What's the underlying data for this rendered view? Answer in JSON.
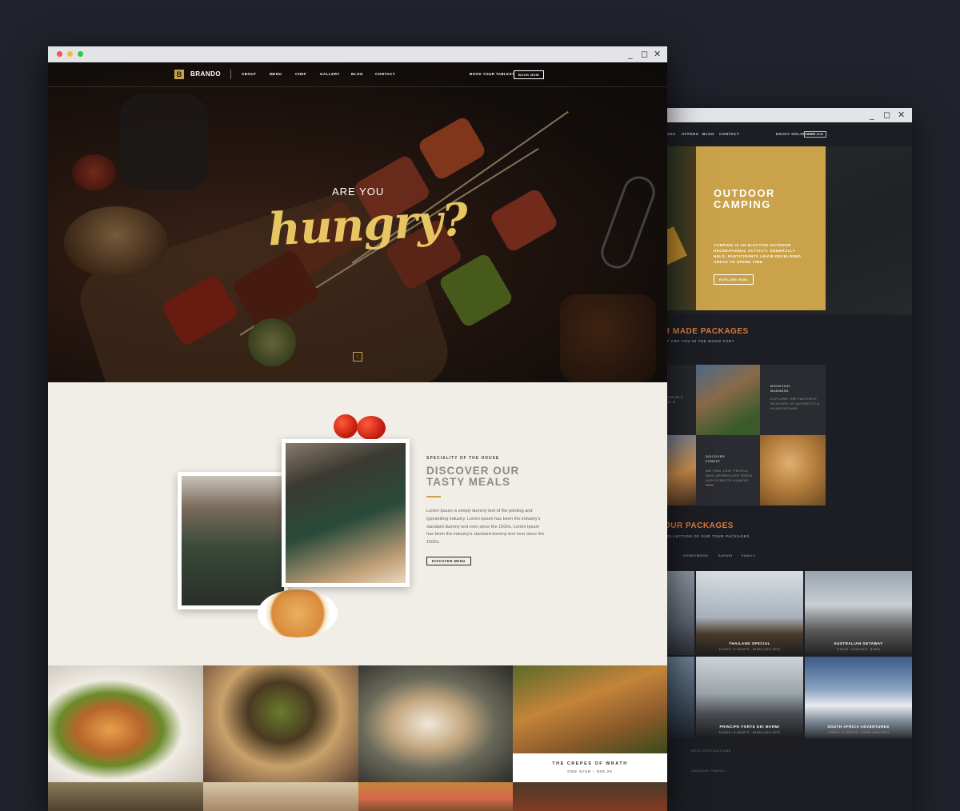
{
  "back_window": {
    "nav": [
      "ICES",
      "OFFERS",
      "BLOG",
      "CONTACT"
    ],
    "nav_cta_text": "ENJOY HOLIDAYS?",
    "nav_cta_button": "BOOK NOW",
    "hero": {
      "title_line1": "OUTDOOR",
      "title_line2": "CAMPING",
      "text": "CAMPING IS AN ELECTIVE OUTDOOR RECREATIONAL ACTIVITY. GENERALLY HELD, PARTICIPANTS LEAVE DEVELOPED AREAS TO SPEND TIME.",
      "button": "EXPLORE NOW"
    },
    "packages_heading": "R MADE PACKAGES",
    "packages_sub": "AT ARE YOU IN THE MOOD FOR?",
    "tiles": [
      {
        "title": "MOUNTAIN\nMADNESS",
        "text": "EXPLORE THE FARTHEST\nREACHES OF ANTARCTICA\nIN MOUNTAINS."
      },
      {
        "title": "DISCOVER\nFOREST",
        "text": "WE FIND THAT PEOPLE\nWHO APPRECIATE TREES\nAND FORESTS ALWAYS"
      },
      {
        "title": "",
        "text": "TORABLE\nWS R"
      }
    ],
    "tour_heading": "OUR PACKAGES",
    "tour_sub": "COLLECTION OF OUR TOUR PACKAGES",
    "filters": [
      "S",
      "HONEYMOON",
      "SAFARI",
      "FAMILY"
    ],
    "tours": [
      {
        "title": "THAILAND SPECIAL",
        "sub": "6 DAYS / 5 NIGHTS - $1950 (30% OFF)"
      },
      {
        "title": "AUSTRALIAN GETAWAY",
        "sub": "5 DAYS / 4 NIGHTS - $1850"
      },
      {
        "title": "PRINCIPE FORTE DEI MARMI",
        "sub": "5 DAYS / 4 NIGHTS - $1950 (30% OFF)"
      },
      {
        "title": "SOUTH AFRICA ADVENTURES",
        "sub": "5 DAYS / 4 NIGHTS - $1950 (30% OFF)"
      }
    ],
    "footer_items": [
      "BEST DESTINATIONS",
      "AMAZING TRAVEL"
    ]
  },
  "main_window": {
    "logo_letter": "B",
    "brand": "BRANDO",
    "nav": [
      "ABOUT",
      "MENU",
      "CHEF",
      "GALLERY",
      "BLOG",
      "CONTACT"
    ],
    "book_text": "BOOK YOUR TABLES?",
    "book_button": "BOOK NOW",
    "hero_small": "ARE YOU",
    "hero_big": "hungry?",
    "scroll_icon": "↓",
    "speciality": {
      "kicker": "SPECIALITY OF THE HOUSE",
      "title_line1": "DISCOVER OUR",
      "title_line2": "TASTY MEALS",
      "body": "Lorem Ipsum is simply dummy text of the printing and typesetting industry. Lorem Ipsum has been the industry's standard dummy text ever since the 1500s. Lorem Ipsum has been the industry's standard dummy text ever since the 1500s.",
      "button": "DISCOVER MENU"
    },
    "gallery_caption": {
      "title": "THE CREPES OF WRATH",
      "sub": "ONE DISH - $09.25"
    }
  },
  "colors": {
    "gold": "#c9a24a",
    "accent_orange": "#d77a3b",
    "background": "#20232b"
  }
}
